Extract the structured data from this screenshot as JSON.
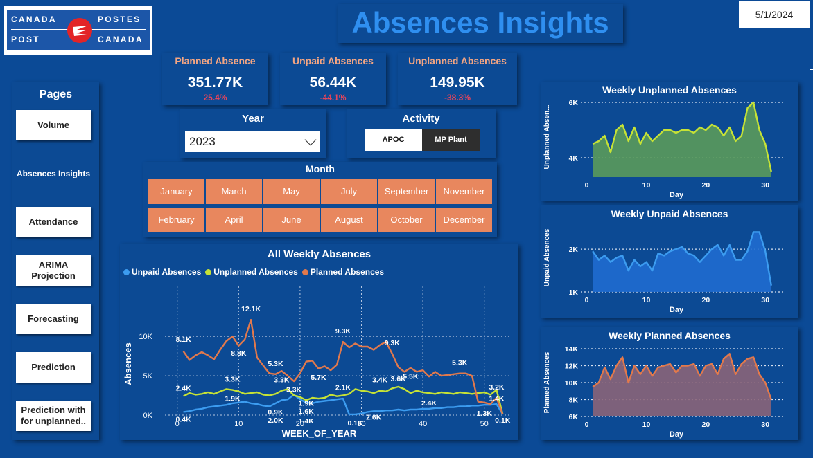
{
  "logo": {
    "line1_left": "CANADA",
    "line1_right": "POSTES",
    "line2_left": "POST",
    "line2_right": "CANADA"
  },
  "title": "Absences Insights",
  "date": "5/1/2024",
  "pages": {
    "title": "Pages",
    "items": [
      "Volume",
      "Absences Insights",
      "Attendance",
      "ARIMA Projection",
      "Forecasting",
      "Prediction",
      "Prediction with for unplanned.."
    ],
    "active": "Absences Insights"
  },
  "kpis": [
    {
      "label": "Planned Absence",
      "value": "351.77K",
      "delta": "25.4%"
    },
    {
      "label": "Unpaid Absences",
      "value": "56.44K",
      "delta": "-44.1%"
    },
    {
      "label": "Unplanned Absences",
      "value": "149.95K",
      "delta": "-38.3%"
    }
  ],
  "year": {
    "title": "Year",
    "value": "2023"
  },
  "activity": {
    "title": "Activity",
    "options": [
      "APOC",
      "MP Plant"
    ]
  },
  "month": {
    "title": "Month",
    "row1": [
      "January",
      "March",
      "May",
      "July",
      "September",
      "November"
    ],
    "row2": [
      "February",
      "April",
      "June",
      "August",
      "October",
      "December"
    ]
  },
  "colors": {
    "unpaid": "#3c9cf0",
    "unplanned": "#c6e236",
    "planned": "#e2794c",
    "accent": "#2f8ff0"
  },
  "chart_data": [
    {
      "type": "line",
      "title": "All Weekly Absences",
      "xlabel": "WEEK_OF_YEAR",
      "ylabel": "Absences",
      "x_ticks": [
        "0",
        "10",
        "20",
        "30",
        "40",
        "50"
      ],
      "y_ticks": [
        "0K",
        "5K",
        "10K"
      ],
      "xlim": [
        -2,
        55
      ],
      "ylim": [
        0,
        13000
      ],
      "x": [
        1,
        2,
        3,
        4,
        5,
        6,
        7,
        8,
        9,
        10,
        11,
        12,
        13,
        14,
        15,
        16,
        17,
        18,
        19,
        20,
        21,
        22,
        23,
        24,
        25,
        26,
        27,
        28,
        29,
        30,
        31,
        32,
        33,
        34,
        35,
        36,
        37,
        38,
        39,
        40,
        41,
        42,
        43,
        44,
        45,
        46,
        47,
        48,
        49,
        50,
        51,
        52,
        53
      ],
      "series": [
        {
          "name": "Unpaid Absences",
          "color": "#3c9cf0",
          "values": [
            400,
            500,
            700,
            800,
            1000,
            1100,
            1200,
            1300,
            1500,
            1600,
            1700,
            1500,
            1400,
            1200,
            1100,
            1500,
            1900,
            2000,
            2600,
            2000,
            1600,
            1500,
            1700,
            1800,
            1900,
            2000,
            2100,
            100,
            100,
            200,
            400,
            500,
            500,
            600,
            600,
            700,
            600,
            700,
            700,
            800,
            800,
            900,
            900,
            1000,
            1000,
            1100,
            1100,
            1200,
            1200,
            1300,
            1300,
            1400,
            100
          ]
        },
        {
          "name": "Unplanned Absences",
          "color": "#c6e236",
          "values": [
            2400,
            2800,
            2600,
            2700,
            2900,
            2700,
            3000,
            3300,
            3200,
            3000,
            2700,
            2800,
            2900,
            2600,
            2500,
            2700,
            3100,
            3300,
            2500,
            2300,
            1900,
            2200,
            2100,
            2200,
            2600,
            2400,
            2500,
            2700,
            3300,
            3100,
            3000,
            2800,
            3100,
            3000,
            3400,
            3600,
            3300,
            2800,
            3100,
            2900,
            2800,
            2700,
            2900,
            2800,
            2700,
            2900,
            2800,
            2700,
            2800,
            2900,
            2600,
            3200,
            100
          ]
        },
        {
          "name": "Planned Absences",
          "color": "#e2794c",
          "values": [
            8100,
            7000,
            7600,
            8000,
            7600,
            7100,
            8300,
            9400,
            10000,
            8800,
            9600,
            12100,
            7300,
            6300,
            5300,
            5200,
            5600,
            5000,
            4300,
            5300,
            6800,
            6900,
            5900,
            6200,
            5700,
            6400,
            9300,
            8600,
            9100,
            8700,
            8700,
            8300,
            8900,
            9300,
            7800,
            6100,
            5500,
            6000,
            5500,
            5700,
            4900,
            5500,
            5000,
            5100,
            5200,
            5300,
            5300,
            5000,
            1700,
            1600,
            1400,
            2200,
            100
          ]
        }
      ],
      "labels": [
        {
          "series": "Planned Absences",
          "text": "8.1K"
        },
        {
          "series": "Planned Absences",
          "text": "12.1K"
        },
        {
          "series": "Planned Absences",
          "text": "8.8K"
        },
        {
          "series": "Planned Absences",
          "text": "5.3K"
        },
        {
          "series": "Planned Absences",
          "text": "5.7K"
        },
        {
          "series": "Planned Absences",
          "text": "9.3K"
        },
        {
          "series": "Planned Absences",
          "text": "9.3K"
        },
        {
          "series": "Planned Absences",
          "text": "5.5K"
        },
        {
          "series": "Planned Absences",
          "text": "5.3K"
        },
        {
          "series": "Planned Absences",
          "text": "3.2K"
        },
        {
          "series": "Unplanned Absences",
          "text": "2.4K"
        },
        {
          "series": "Unplanned Absences",
          "text": "3.3K"
        },
        {
          "series": "Unplanned Absences",
          "text": "1.9K"
        },
        {
          "series": "Unplanned Absences",
          "text": "3.3K"
        },
        {
          "series": "Unplanned Absences",
          "text": "3.3K"
        },
        {
          "series": "Unplanned Absences",
          "text": "1.9K"
        },
        {
          "series": "Unplanned Absences",
          "text": "2.1K"
        },
        {
          "series": "Unplanned Absences",
          "text": "3.4K"
        },
        {
          "series": "Unplanned Absences",
          "text": "3.6K"
        },
        {
          "series": "Unplanned Absences",
          "text": "1.4K"
        },
        {
          "series": "Unpaid Absences",
          "text": "0.4K"
        },
        {
          "series": "Unpaid Absences",
          "text": "0.9K"
        },
        {
          "series": "Unpaid Absences",
          "text": "2.0K"
        },
        {
          "series": "Unpaid Absences",
          "text": "1.6K"
        },
        {
          "series": "Unpaid Absences",
          "text": "1.4K"
        },
        {
          "series": "Unpaid Absences",
          "text": "0.1K"
        },
        {
          "series": "Unpaid Absences",
          "text": "2.6K"
        },
        {
          "series": "Unpaid Absences",
          "text": "2.4K"
        },
        {
          "series": "Unpaid Absences",
          "text": "1.3K"
        },
        {
          "series": "Unpaid Absences",
          "text": "0.1K"
        }
      ]
    },
    {
      "type": "area",
      "title": "Weekly Unplanned Absences",
      "xlabel": "Day",
      "ylabel": "Unplanned Absen...",
      "color": "#c6e236",
      "fill": "#5a9a5a",
      "x_ticks": [
        "0",
        "10",
        "20",
        "30"
      ],
      "y_ticks": [
        "4K",
        "6K"
      ],
      "ylim": [
        3300,
        6200
      ],
      "x": [
        1,
        2,
        3,
        4,
        5,
        6,
        7,
        8,
        9,
        10,
        11,
        12,
        13,
        14,
        15,
        16,
        17,
        18,
        19,
        20,
        21,
        22,
        23,
        24,
        25,
        26,
        27,
        28,
        29,
        30,
        31
      ],
      "values": [
        4500,
        4600,
        4800,
        4200,
        5000,
        5200,
        4600,
        5100,
        4500,
        4900,
        4600,
        4800,
        5000,
        5000,
        4900,
        5000,
        5000,
        4900,
        5100,
        5000,
        5200,
        5100,
        4800,
        5100,
        4600,
        4800,
        5800,
        6000,
        5000,
        4500,
        3500
      ]
    },
    {
      "type": "area",
      "title": "Weekly Unpaid Absences",
      "xlabel": "Day",
      "ylabel": "Unpaid Absences",
      "color": "#3c9cf0",
      "fill": "#1f6ccf",
      "x_ticks": [
        "0",
        "10",
        "20",
        "30"
      ],
      "y_ticks": [
        "1K",
        "2K"
      ],
      "ylim": [
        1000,
        2600
      ],
      "x": [
        1,
        2,
        3,
        4,
        5,
        6,
        7,
        8,
        9,
        10,
        11,
        12,
        13,
        14,
        15,
        16,
        17,
        18,
        19,
        20,
        21,
        22,
        23,
        24,
        25,
        26,
        27,
        28,
        29,
        30,
        31
      ],
      "values": [
        1950,
        1750,
        1850,
        1700,
        1800,
        1850,
        1500,
        1750,
        1600,
        1700,
        1500,
        1900,
        1850,
        1950,
        2000,
        2050,
        1900,
        1850,
        1700,
        1850,
        2000,
        2100,
        1850,
        2100,
        1750,
        1750,
        1950,
        2400,
        2400,
        1950,
        1150
      ]
    },
    {
      "type": "area",
      "title": "Weekly Planned Absences",
      "xlabel": "Day",
      "ylabel": "Planned Absences",
      "color": "#e2794c",
      "fill": "#8a6478",
      "x_ticks": [
        "0",
        "10",
        "20",
        "30"
      ],
      "y_ticks": [
        "6K",
        "8K",
        "10K",
        "12K",
        "14K"
      ],
      "ylim": [
        6000,
        14000
      ],
      "x": [
        1,
        2,
        3,
        4,
        5,
        6,
        7,
        8,
        9,
        10,
        11,
        12,
        13,
        14,
        15,
        16,
        17,
        18,
        19,
        20,
        21,
        22,
        23,
        24,
        25,
        26,
        27,
        28,
        29,
        30,
        31
      ],
      "values": [
        9500,
        10000,
        11800,
        10400,
        12000,
        13000,
        10000,
        12000,
        11000,
        12000,
        10800,
        11800,
        12000,
        12200,
        11200,
        12000,
        12000,
        12200,
        10800,
        12000,
        12200,
        11000,
        12800,
        13400,
        11000,
        12200,
        12800,
        13000,
        11000,
        10000,
        8000
      ]
    }
  ]
}
